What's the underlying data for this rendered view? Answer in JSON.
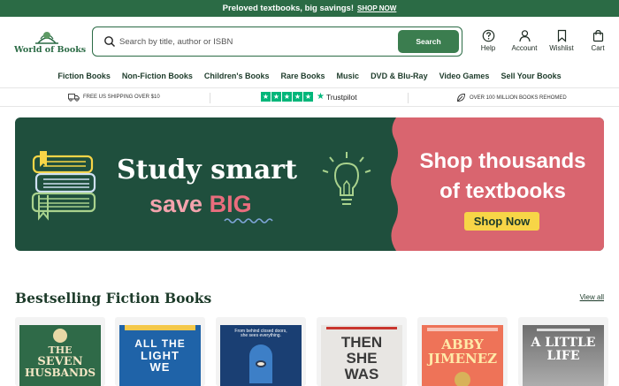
{
  "promo": {
    "text": "Preloved textbooks, big savings!",
    "link": "SHOP NOW"
  },
  "logo": {
    "text": "World of Books"
  },
  "search": {
    "placeholder": "Search by title, author or ISBN",
    "button": "Search"
  },
  "header_actions": [
    {
      "label": "Help",
      "icon": "help-circle-icon"
    },
    {
      "label": "Account",
      "icon": "user-icon"
    },
    {
      "label": "Wishlist",
      "icon": "bookmark-icon"
    },
    {
      "label": "Cart",
      "icon": "shopping-bag-icon"
    }
  ],
  "nav": [
    "Fiction Books",
    "Non-Fiction Books",
    "Children's Books",
    "Rare Books",
    "Music",
    "DVD & Blu-Ray",
    "Video Games",
    "Sell Your Books"
  ],
  "trust": {
    "shipping": "FREE US SHIPPING OVER $10",
    "trustpilot": "Trustpilot",
    "rehomed": "OVER 100 MILLION BOOKS REHOMED"
  },
  "banner": {
    "title": "Study smart",
    "sub_prefix": "save ",
    "sub_big": "BIG",
    "shop_line1": "Shop thousands",
    "shop_line2": "of textbooks",
    "button": "Shop Now"
  },
  "section": {
    "title": "Bestselling Fiction Books",
    "view_all": "View all"
  },
  "books": [
    {
      "title_lines": [
        "THE",
        "SEVEN",
        "HUSBANDS"
      ],
      "bg": "#2f6a48",
      "fg": "#f3e6c4"
    },
    {
      "title_lines": [
        "ALL THE",
        "LIGHT",
        "WE"
      ],
      "bg": "#1f63a8",
      "fg": "#ffffff"
    },
    {
      "title_lines": [
        "From behind closed doors,",
        "she sees everything."
      ],
      "bg": "#1a3f73",
      "fg": "#ffffff"
    },
    {
      "title_lines": [
        "THEN",
        "SHE",
        "WAS"
      ],
      "bg": "#e8e6e3",
      "fg": "#3a3a3a"
    },
    {
      "title_lines": [
        "ABBY",
        "JIMENEZ"
      ],
      "bg": "#ee7358",
      "fg": "#ffe9a8"
    },
    {
      "title_lines": [
        "A LITTLE",
        "LIFE"
      ],
      "bg": "#8e8e8e",
      "fg": "#ffffff"
    }
  ],
  "colors": {
    "brand_green": "#2b6b45",
    "banner_green": "#1f4f3d",
    "banner_pink": "#d9656f",
    "cta_yellow": "#f7d547",
    "trustpilot_green": "#00b67a"
  }
}
